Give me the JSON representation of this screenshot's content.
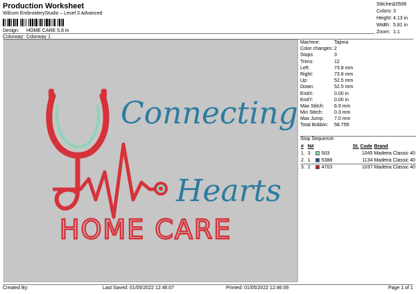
{
  "header": {
    "title": "Production Worksheet",
    "subtitle": "Wilcom EmbroideryStudio – Level 3 Advanced"
  },
  "meta": {
    "design_label": "Design:",
    "design_value": "HOME CARE 5,8 in",
    "colorway_label": "Colorway:",
    "colorway_value": "Colorway 1"
  },
  "stats": [
    {
      "label": "Stitches:",
      "value": "10596"
    },
    {
      "label": "Colors:",
      "value": "3"
    },
    {
      "label": "Height:",
      "value": "4.13 in"
    },
    {
      "label": "Width:",
      "value": "5.81 in"
    },
    {
      "label": "Zoom:",
      "value": "1:1"
    }
  ],
  "details": [
    {
      "label": "Machine:",
      "value": "Tajima"
    },
    {
      "label": "Color changes:",
      "value": "2"
    },
    {
      "label": "Stops:",
      "value": "3"
    },
    {
      "label": "Trims:",
      "value": "12"
    },
    {
      "label": "Left:",
      "value": "73.8 mm"
    },
    {
      "label": "Right:",
      "value": "73.8 mm"
    },
    {
      "label": "Up:",
      "value": "52.5 mm"
    },
    {
      "label": "Down:",
      "value": "52.5 mm"
    },
    {
      "label": "EndX:",
      "value": "0.00 in"
    },
    {
      "label": "EndY:",
      "value": "0.00 in"
    },
    {
      "label": "Max Stitch:",
      "value": "6.9 mm"
    },
    {
      "label": "Min Stitch:",
      "value": "0.3 mm"
    },
    {
      "label": "Max Jump:",
      "value": "7.0 mm"
    },
    {
      "label": "Total Bobbin:",
      "value": "58.75ft"
    }
  ],
  "sequence": {
    "title": "Stop Sequence:",
    "columns": [
      "#",
      "N#",
      "St.",
      "Code",
      "Brand"
    ],
    "rows": [
      {
        "num": "1.",
        "n": "3",
        "swatch": "#8fd3b6",
        "code": "503",
        "st": "1045",
        "brand": "Madeira Classic 40"
      },
      {
        "num": "2.",
        "n": "1",
        "swatch": "#1f4d8a",
        "code": "5388",
        "st": "1134",
        "brand": "Madeira Classic 40"
      },
      {
        "num": "3.",
        "n": "2",
        "swatch": "#b0202a",
        "code": "4703",
        "st": "1037",
        "brand": "Madeira Classic 40"
      }
    ]
  },
  "design_art": {
    "line1": "Connecting",
    "line2": "Hearts",
    "line3": "HOME CARE",
    "colors": {
      "red": "#d6323a",
      "blue": "#2c7ba0",
      "mint": "#8fd3b6",
      "canvas": "#c6c6c6"
    }
  },
  "footer": {
    "created": "Created By:",
    "saved": "Last Saved: 01/05/2022 12:46:07",
    "printed": "Printed: 01/05/2022 12:46:09",
    "page": "Page 1 of 1"
  }
}
